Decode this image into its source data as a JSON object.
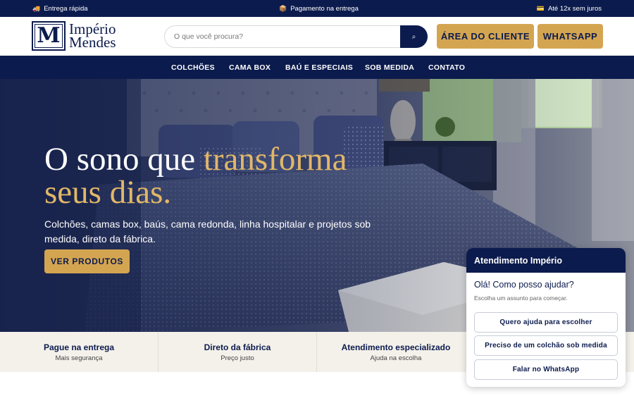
{
  "topbar": {
    "items": [
      {
        "icon": "truck-icon",
        "glyph": "🚚",
        "text": "Entrega rápida"
      },
      {
        "icon": "package-icon",
        "glyph": "📦",
        "text": "Pagamento na entrega"
      },
      {
        "icon": "card-icon",
        "glyph": "💳",
        "text": "Até 12x sem juros"
      }
    ]
  },
  "header": {
    "logo": {
      "mark": "M",
      "line1": "Império",
      "line2": "Mendes"
    },
    "search": {
      "placeholder": "O que você procura?",
      "value": "",
      "icon": "search-icon",
      "glyph": "⌕"
    },
    "client_button": "ÁREA DO CLIENTE",
    "whatsapp_button": "WHATSAPP"
  },
  "nav": {
    "items": [
      "COLCHÕES",
      "CAMA BOX",
      "BAÚ E ESPECIAIS",
      "SOB MEDIDA",
      "CONTATO"
    ]
  },
  "hero": {
    "title_part1": "O sono que",
    "title_highlight": "transforma",
    "title_line2": "seus dias.",
    "subtitle": "Colchões, camas box, baús, cama redonda, linha hospitalar e projetos sob medida, direto da fábrica.",
    "cta": "VER PRODUTOS"
  },
  "benefits": [
    {
      "title": "Pague na entrega",
      "subtitle": "Mais segurança"
    },
    {
      "title": "Direto da fábrica",
      "subtitle": "Preço justo"
    },
    {
      "title": "Atendimento especializado",
      "subtitle": "Ajuda na escolha"
    }
  ],
  "chat": {
    "header": "Atendimento Império",
    "greeting": "Olá! Como posso ajudar?",
    "hint": "Escolha um assunto para começar.",
    "options": [
      "Quero ajuda para escolher",
      "Preciso de um colchão sob medida",
      "Falar no WhatsApp"
    ]
  },
  "colors": {
    "navy": "#0c1b4d",
    "gold": "#d4a551",
    "hero_gold_text": "#e2b767",
    "benefits_bg": "#f4f1eb"
  }
}
